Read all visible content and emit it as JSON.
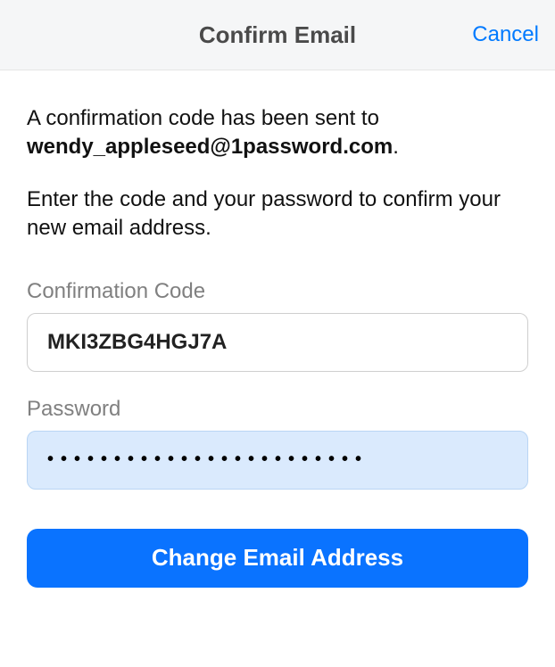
{
  "header": {
    "title": "Confirm Email",
    "cancel": "Cancel"
  },
  "intro": {
    "prefix": "A confirmation code has been sent to ",
    "email": "wendy_appleseed@1password.com",
    "suffix": ".",
    "second": "Enter the code and your password to confirm your new email address."
  },
  "fields": {
    "code_label": "Confirmation Code",
    "code_value": "MKI3ZBG4HGJ7A",
    "password_label": "Password",
    "password_value": "••••••••••••••••••••••••"
  },
  "button": {
    "label": "Change Email Address"
  }
}
